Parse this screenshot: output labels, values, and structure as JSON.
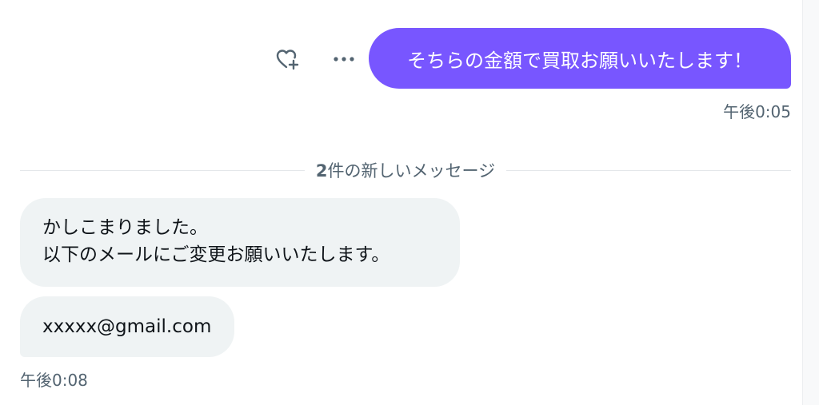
{
  "messages": {
    "outgoing": {
      "text": "そちらの金額で買取お願いいたします！",
      "time": "午後0:05",
      "actions": {
        "react_icon": "heart-plus-icon",
        "more_icon": "more-dots-icon"
      }
    },
    "divider": {
      "count": "2",
      "label": "件の新しいメッセージ"
    },
    "incoming": [
      {
        "line1": "かしこまりました。",
        "line2": "以下のメールにご変更お願いいたします。"
      },
      {
        "text": "xxxxx@gmail.com"
      }
    ],
    "incoming_time": "午後0:08"
  },
  "colors": {
    "outgoing_bubble": "#7856ff",
    "incoming_bubble": "#eff3f4",
    "secondary_text": "#536471"
  }
}
